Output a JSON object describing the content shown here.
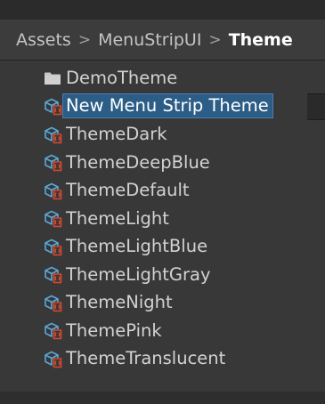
{
  "breadcrumb": {
    "items": [
      "Assets",
      "MenuStripUI",
      "Theme"
    ],
    "separator": ">"
  },
  "folder": {
    "label": "DemoTheme",
    "icon": "folder-icon"
  },
  "items": [
    {
      "label": "New Menu Strip Theme",
      "icon": "scriptable-object-icon",
      "selected": true
    },
    {
      "label": "ThemeDark",
      "icon": "scriptable-object-icon"
    },
    {
      "label": "ThemeDeepBlue",
      "icon": "scriptable-object-icon"
    },
    {
      "label": "ThemeDefault",
      "icon": "scriptable-object-icon"
    },
    {
      "label": "ThemeLight",
      "icon": "scriptable-object-icon"
    },
    {
      "label": "ThemeLightBlue",
      "icon": "scriptable-object-icon"
    },
    {
      "label": "ThemeLightGray",
      "icon": "scriptable-object-icon"
    },
    {
      "label": "ThemeNight",
      "icon": "scriptable-object-icon"
    },
    {
      "label": "ThemePink",
      "icon": "scriptable-object-icon"
    },
    {
      "label": "ThemeTranslucent",
      "icon": "scriptable-object-icon"
    }
  ],
  "colors": {
    "background": "#383838",
    "selection": "#2c5d87",
    "text": "#d2d2d2",
    "icon_blue": "#59a8d8",
    "icon_red": "#d9492e"
  }
}
